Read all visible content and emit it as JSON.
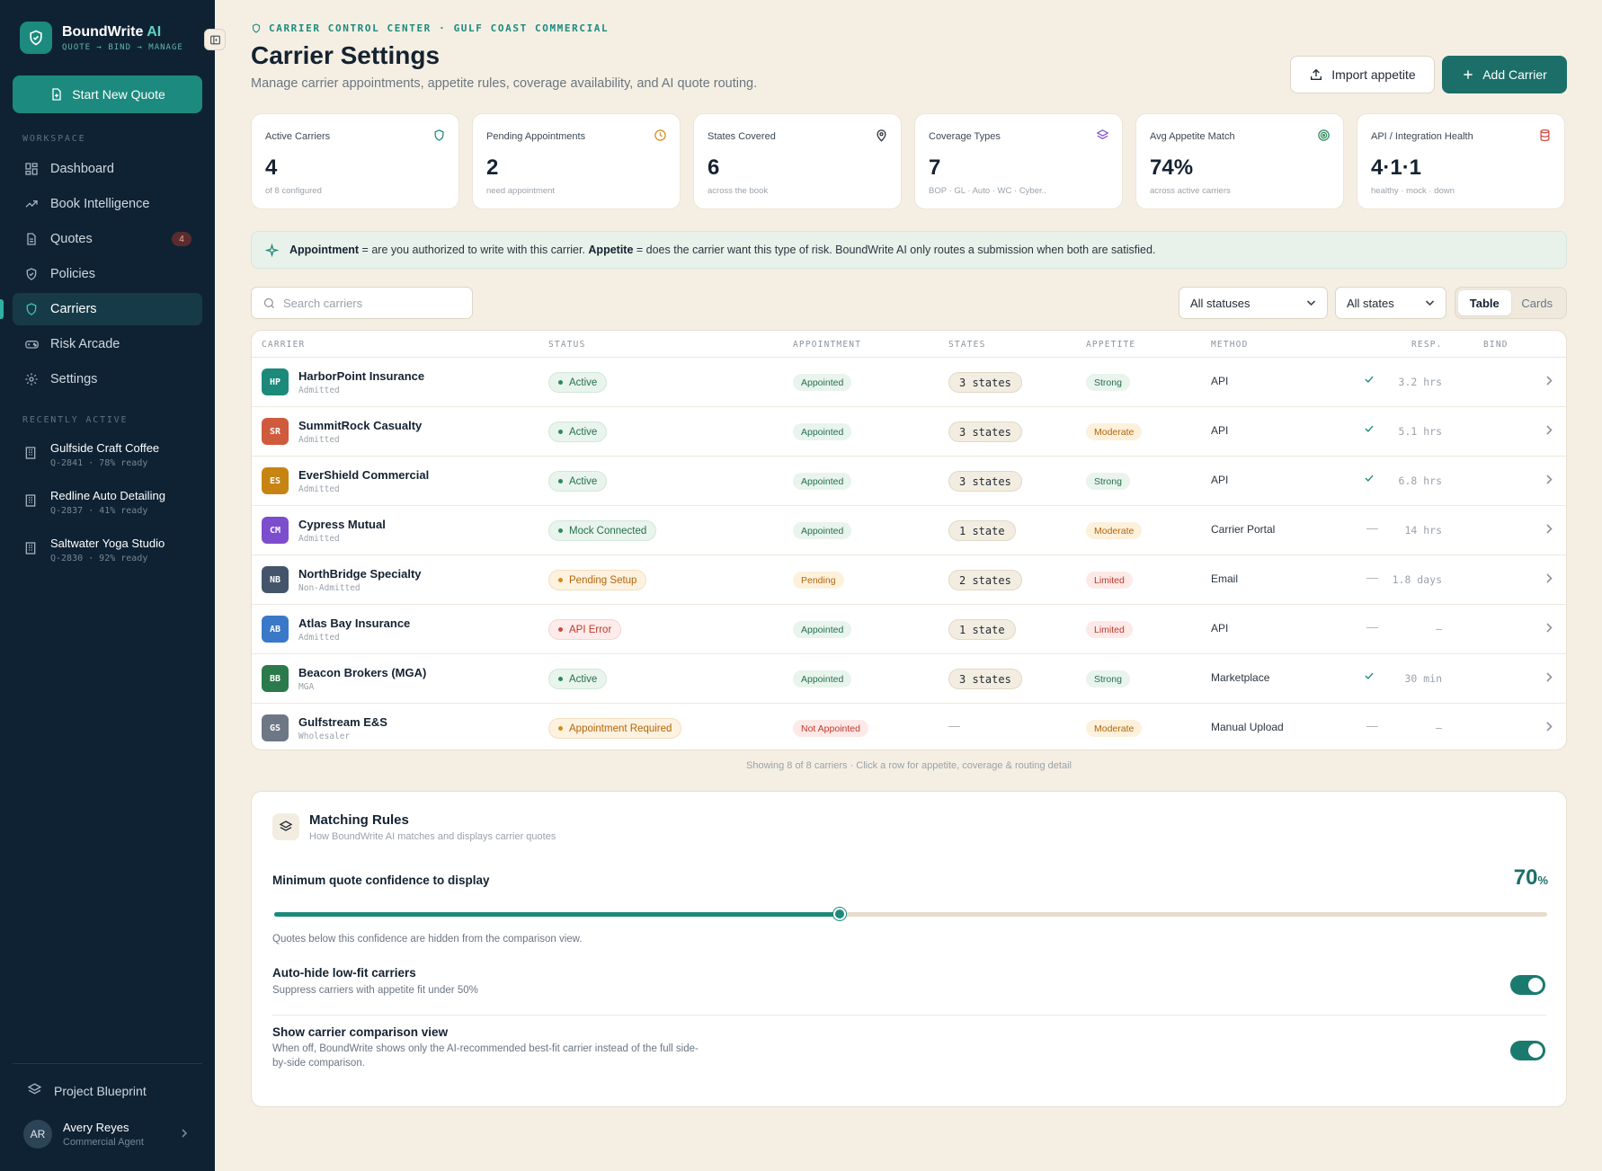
{
  "brand": {
    "name": "BoundWrite",
    "name_ai": " AI",
    "tagline": "QUOTE → BIND → MANAGE"
  },
  "sidebar": {
    "start_quote": "Start New Quote",
    "workspace_label": "WORKSPACE",
    "items": [
      {
        "label": "Dashboard",
        "icon": "grid-icon"
      },
      {
        "label": "Book Intelligence",
        "icon": "trend-icon"
      },
      {
        "label": "Quotes",
        "icon": "document-icon",
        "badge": "4"
      },
      {
        "label": "Policies",
        "icon": "shield-check-icon"
      },
      {
        "label": "Carriers",
        "icon": "shield-icon",
        "active": true
      },
      {
        "label": "Risk Arcade",
        "icon": "gamepad-icon"
      },
      {
        "label": "Settings",
        "icon": "gear-icon"
      }
    ],
    "recent_label": "RECENTLY ACTIVE",
    "recent": [
      {
        "name": "Gulfside Craft Coffee",
        "meta": "Q-2841 · 78% ready"
      },
      {
        "name": "Redline Auto Detailing",
        "meta": "Q-2837 · 41% ready"
      },
      {
        "name": "Saltwater Yoga Studio",
        "meta": "Q-2830 · 92% ready"
      }
    ],
    "blueprint": "Project Blueprint",
    "user": {
      "initials": "AR",
      "name": "Avery Reyes",
      "role": "Commercial Agent"
    }
  },
  "header": {
    "eyebrow": "CARRIER CONTROL CENTER · GULF COAST COMMERCIAL",
    "title": "Carrier Settings",
    "subtitle": "Manage carrier appointments, appetite rules, coverage availability, and AI quote routing.",
    "import_label": "Import appetite",
    "add_label": "Add Carrier"
  },
  "stats": [
    {
      "label": "Active Carriers",
      "value": "4",
      "sub": "of 8 configured",
      "icon": "shield-icon",
      "color": "#1b8a7a"
    },
    {
      "label": "Pending Appointments",
      "value": "2",
      "sub": "need appointment",
      "icon": "clock-icon",
      "color": "#d68a18"
    },
    {
      "label": "States Covered",
      "value": "6",
      "sub": "across the book",
      "icon": "map-pin-icon",
      "color": "#1f2a33"
    },
    {
      "label": "Coverage Types",
      "value": "7",
      "sub": "BOP · GL · Auto · WC · Cyber..",
      "icon": "layers-icon",
      "color": "#7c4dcc"
    },
    {
      "label": "Avg Appetite Match",
      "value": "74%",
      "sub": "across active carriers",
      "icon": "target-icon",
      "color": "#2b8a5b"
    },
    {
      "label": "API / Integration Health",
      "value": "4·1·1",
      "sub": "healthy · mock · down",
      "icon": "database-icon",
      "color": "#d04a3c"
    }
  ],
  "info": {
    "term1": "Appointment",
    "text1": " = are you authorized to write with this carrier. ",
    "term2": "Appetite",
    "text2": " = does the carrier want this type of risk. BoundWrite AI only routes a submission when both are satisfied."
  },
  "filters": {
    "search_placeholder": "Search carriers",
    "status": "All statuses",
    "states": "All states",
    "view_table": "Table",
    "view_cards": "Cards"
  },
  "table": {
    "columns": [
      "CARRIER",
      "STATUS",
      "APPOINTMENT",
      "STATES",
      "APPETITE",
      "METHOD",
      "RESP.",
      "BIND"
    ],
    "rows": [
      {
        "initials": "HP",
        "color": "#1b8a7a",
        "name": "HarborPoint Insurance",
        "type": "Admitted",
        "status": "Active",
        "status_tone": "green",
        "appointment": "Appointed",
        "appt_tone": "green",
        "states": "3 states",
        "appetite": "Strong",
        "appetite_tone": "green",
        "method": "API",
        "resp": "3.2 hrs",
        "bind": true
      },
      {
        "initials": "SR",
        "color": "#cf5a3c",
        "name": "SummitRock Casualty",
        "type": "Admitted",
        "status": "Active",
        "status_tone": "green",
        "appointment": "Appointed",
        "appt_tone": "green",
        "states": "3 states",
        "appetite": "Moderate",
        "appetite_tone": "amber",
        "method": "API",
        "resp": "5.1 hrs",
        "bind": true
      },
      {
        "initials": "ES",
        "color": "#c78412",
        "name": "EverShield Commercial",
        "type": "Admitted",
        "status": "Active",
        "status_tone": "green",
        "appointment": "Appointed",
        "appt_tone": "green",
        "states": "3 states",
        "appetite": "Strong",
        "appetite_tone": "green",
        "method": "API",
        "resp": "6.8 hrs",
        "bind": true
      },
      {
        "initials": "CM",
        "color": "#7c4dcc",
        "name": "Cypress Mutual",
        "type": "Admitted",
        "status": "Mock Connected",
        "status_tone": "green",
        "appointment": "Appointed",
        "appt_tone": "green",
        "states": "1 state",
        "appetite": "Moderate",
        "appetite_tone": "amber",
        "method": "Carrier Portal",
        "resp": "14 hrs",
        "bind": false
      },
      {
        "initials": "NB",
        "color": "#44546a",
        "name": "NorthBridge Specialty",
        "type": "Non-Admitted",
        "status": "Pending Setup",
        "status_tone": "amber",
        "appointment": "Pending",
        "appt_tone": "amber",
        "states": "2 states",
        "appetite": "Limited",
        "appetite_tone": "red",
        "method": "Email",
        "resp": "1.8 days",
        "bind": false
      },
      {
        "initials": "AB",
        "color": "#3a78c8",
        "name": "Atlas Bay Insurance",
        "type": "Admitted",
        "status": "API Error",
        "status_tone": "red",
        "appointment": "Appointed",
        "appt_tone": "green",
        "states": "1 state",
        "appetite": "Limited",
        "appetite_tone": "red",
        "method": "API",
        "resp": "—",
        "bind": false
      },
      {
        "initials": "BB",
        "color": "#2b7a4b",
        "name": "Beacon Brokers (MGA)",
        "type": "MGA",
        "status": "Active",
        "status_tone": "green",
        "appointment": "Appointed",
        "appt_tone": "green",
        "states": "3 states",
        "appetite": "Strong",
        "appetite_tone": "green",
        "method": "Marketplace",
        "resp": "30 min",
        "bind": true
      },
      {
        "initials": "GS",
        "color": "#6e7785",
        "name": "Gulfstream E&S",
        "type": "Wholesaler",
        "status": "Appointment Required",
        "status_tone": "amber",
        "appointment": "Not Appointed",
        "appt_tone": "red",
        "states": "",
        "appetite": "Moderate",
        "appetite_tone": "amber",
        "method": "Manual Upload",
        "resp": "—",
        "bind": false
      }
    ],
    "footer": "Showing 8 of 8 carriers · Click a row for appetite, coverage & routing detail"
  },
  "rules": {
    "title": "Matching Rules",
    "subtitle": "How BoundWrite AI matches and displays carrier quotes",
    "confidence_label": "Minimum quote confidence to display",
    "confidence_value": 70,
    "confidence_text": "70",
    "confidence_unit": "%",
    "confidence_help": "Quotes below this confidence are hidden from the comparison view.",
    "autohide_title": "Auto-hide low-fit carriers",
    "autohide_desc": "Suppress carriers with appetite fit under 50%",
    "autohide_on": true,
    "compare_title": "Show carrier comparison view",
    "compare_desc": "When off, BoundWrite shows only the AI-recommended best-fit carrier instead of the full side-by-side comparison.",
    "compare_on": true
  }
}
